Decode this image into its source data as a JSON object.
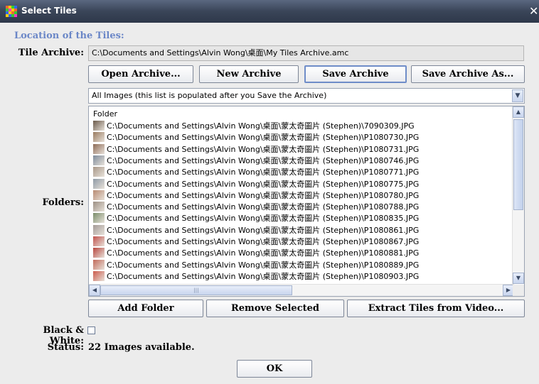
{
  "window": {
    "title": "Select Tiles"
  },
  "location": {
    "section_title": "Location of the Tiles:",
    "archive_label": "Tile Archive:",
    "archive_path": "C:\\Documents and Settings\\Alvin Wong\\桌面\\My Tiles Archive.amc"
  },
  "archive_buttons": {
    "open": "Open Archive...",
    "new": "New Archive",
    "save": "Save Archive",
    "save_as": "Save Archive As..."
  },
  "filter": {
    "selected": "All Images (this list is populated after you Save the Archive)"
  },
  "folders": {
    "label": "Folders:",
    "column_header": "Folder",
    "rows": [
      "C:\\Documents and Settings\\Alvin Wong\\桌面\\蒙太奇圖片 (Stephen)\\7090309.JPG",
      "C:\\Documents and Settings\\Alvin Wong\\桌面\\蒙太奇圖片 (Stephen)\\P1080730.JPG",
      "C:\\Documents and Settings\\Alvin Wong\\桌面\\蒙太奇圖片 (Stephen)\\P1080731.JPG",
      "C:\\Documents and Settings\\Alvin Wong\\桌面\\蒙太奇圖片 (Stephen)\\P1080746.JPG",
      "C:\\Documents and Settings\\Alvin Wong\\桌面\\蒙太奇圖片 (Stephen)\\P1080771.JPG",
      "C:\\Documents and Settings\\Alvin Wong\\桌面\\蒙太奇圖片 (Stephen)\\P1080775.JPG",
      "C:\\Documents and Settings\\Alvin Wong\\桌面\\蒙太奇圖片 (Stephen)\\P1080780.JPG",
      "C:\\Documents and Settings\\Alvin Wong\\桌面\\蒙太奇圖片 (Stephen)\\P1080788.JPG",
      "C:\\Documents and Settings\\Alvin Wong\\桌面\\蒙太奇圖片 (Stephen)\\P1080835.JPG",
      "C:\\Documents and Settings\\Alvin Wong\\桌面\\蒙太奇圖片 (Stephen)\\P1080861.JPG",
      "C:\\Documents and Settings\\Alvin Wong\\桌面\\蒙太奇圖片 (Stephen)\\P1080867.JPG",
      "C:\\Documents and Settings\\Alvin Wong\\桌面\\蒙太奇圖片 (Stephen)\\P1080881.JPG",
      "C:\\Documents and Settings\\Alvin Wong\\桌面\\蒙太奇圖片 (Stephen)\\P1080889.JPG",
      "C:\\Documents and Settings\\Alvin Wong\\桌面\\蒙太奇圖片 (Stephen)\\P1080903.JPG"
    ],
    "thumb_colors": [
      "#6b5a4a",
      "#9a7b60",
      "#8d6b56",
      "#7d8a9b",
      "#a89788",
      "#8e9aa6",
      "#b88a72",
      "#9c8f83",
      "#7a8d6a",
      "#a39a96",
      "#c0504a",
      "#b8463e",
      "#c26a5a",
      "#cc5a4c"
    ]
  },
  "folder_buttons": {
    "add": "Add Folder",
    "remove": "Remove Selected",
    "extract": "Extract Tiles from Video..."
  },
  "options": {
    "bw_label": "Black & White:",
    "bw_checked": false
  },
  "status": {
    "label": "Status:",
    "value": "22 Images available."
  },
  "ok_label": "OK",
  "colors": {
    "accent": "#6b87c7",
    "titlebar": "#3a4558"
  }
}
